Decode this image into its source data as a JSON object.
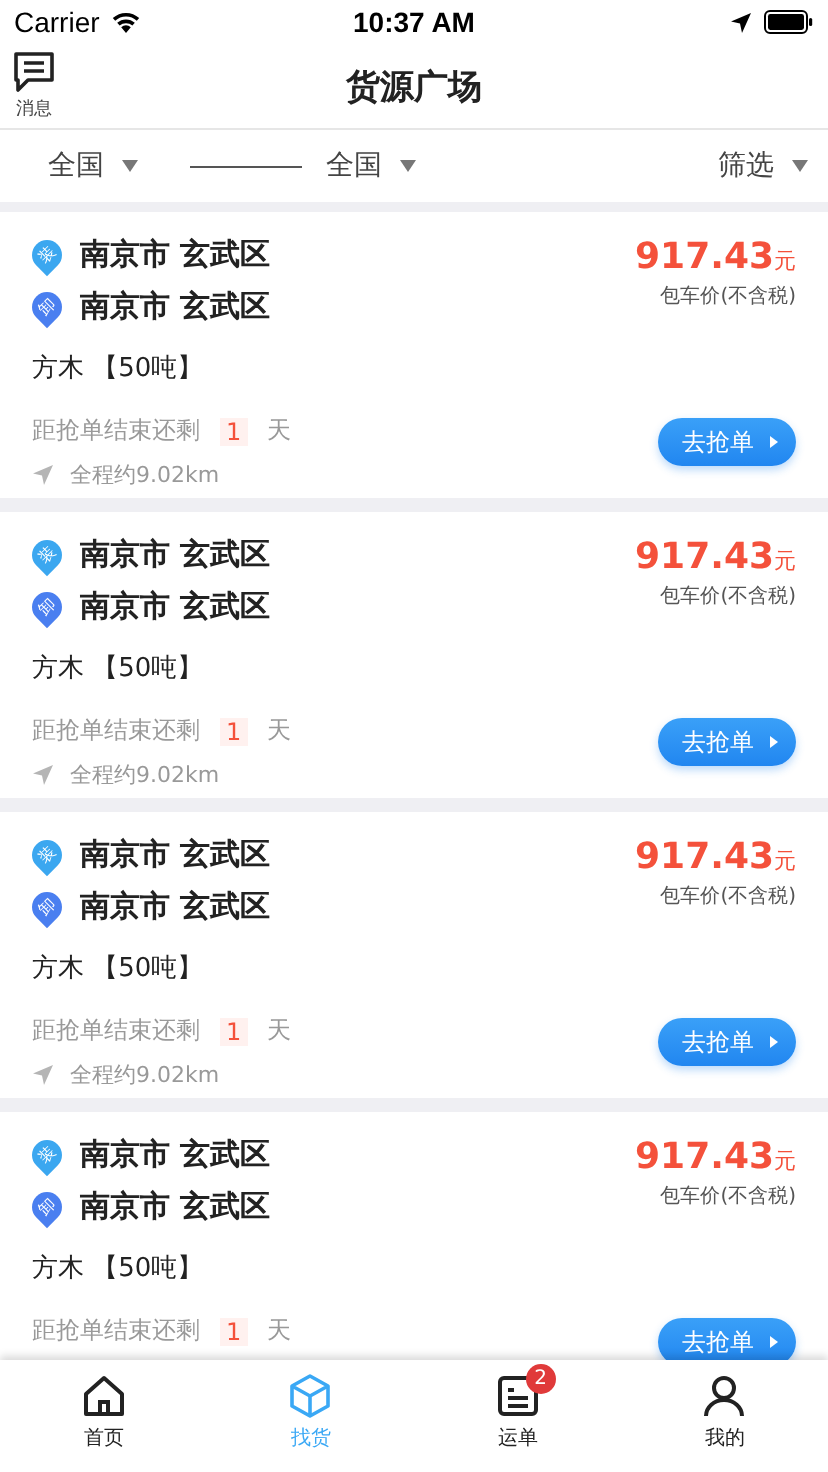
{
  "status_bar": {
    "carrier": "Carrier",
    "time": "10:37 AM"
  },
  "header": {
    "message_label": "消息",
    "title": "货源广场"
  },
  "filters": {
    "origin": "全国",
    "destination": "全国",
    "filter": "筛选"
  },
  "cards": [
    {
      "load_tag": "装",
      "load": "南京市 玄武区",
      "unload_tag": "卸",
      "unload": "南京市 玄武区",
      "cargo": "方木 【50吨】",
      "price": "917.43",
      "currency": "元",
      "price_note": "包车价(不含税)",
      "countdown_label": "距抢单结束还剩",
      "days": "1",
      "days_unit": "天",
      "distance": "全程约9.02km",
      "button": "去抢单"
    },
    {
      "load_tag": "装",
      "load": "南京市 玄武区",
      "unload_tag": "卸",
      "unload": "南京市 玄武区",
      "cargo": "方木 【50吨】",
      "price": "917.43",
      "currency": "元",
      "price_note": "包车价(不含税)",
      "countdown_label": "距抢单结束还剩",
      "days": "1",
      "days_unit": "天",
      "distance": "全程约9.02km",
      "button": "去抢单"
    },
    {
      "load_tag": "装",
      "load": "南京市 玄武区",
      "unload_tag": "卸",
      "unload": "南京市 玄武区",
      "cargo": "方木 【50吨】",
      "price": "917.43",
      "currency": "元",
      "price_note": "包车价(不含税)",
      "countdown_label": "距抢单结束还剩",
      "days": "1",
      "days_unit": "天",
      "distance": "全程约9.02km",
      "button": "去抢单"
    },
    {
      "load_tag": "装",
      "load": "南京市 玄武区",
      "unload_tag": "卸",
      "unload": "南京市 玄武区",
      "cargo": "方木 【50吨】",
      "price": "917.43",
      "currency": "元",
      "price_note": "包车价(不含税)",
      "countdown_label": "距抢单结束还剩",
      "days": "1",
      "days_unit": "天",
      "button": "去抢单"
    }
  ],
  "tab_bar": [
    {
      "kind": "home",
      "label": "首页",
      "selected": false
    },
    {
      "kind": "cube",
      "label": "找货",
      "selected": true
    },
    {
      "kind": "waybill",
      "label": "运单",
      "selected": false,
      "badge": "2"
    },
    {
      "kind": "person",
      "label": "我的",
      "selected": false
    }
  ]
}
